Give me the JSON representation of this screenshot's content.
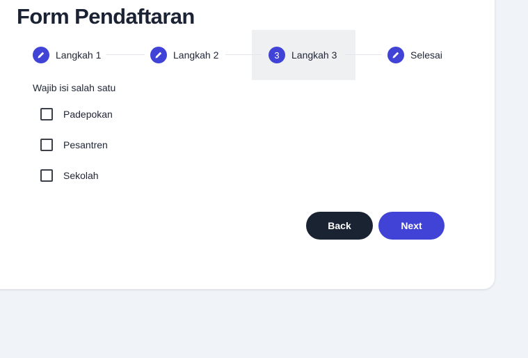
{
  "page": {
    "title": "Form Pendaftaran"
  },
  "stepper": {
    "steps": [
      {
        "label": "Langkah 1",
        "icon": "pencil-icon",
        "state": "completed"
      },
      {
        "label": "Langkah 2",
        "icon": "pencil-icon",
        "state": "completed"
      },
      {
        "label": "Langkah 3",
        "number": "3",
        "state": "active"
      },
      {
        "label": "Selesai",
        "icon": "pencil-icon",
        "state": "completed"
      }
    ]
  },
  "form": {
    "hint": "Wajib isi salah satu",
    "options": [
      {
        "label": "Padepokan",
        "checked": false
      },
      {
        "label": "Pesantren",
        "checked": false
      },
      {
        "label": "Sekolah",
        "checked": false
      }
    ]
  },
  "actions": {
    "back_label": "Back",
    "next_label": "Next"
  },
  "colors": {
    "accent": "#4143d6",
    "dark_button": "#1a2332",
    "page_background": "#f0f3f8",
    "active_step_background": "#eff0f2"
  }
}
